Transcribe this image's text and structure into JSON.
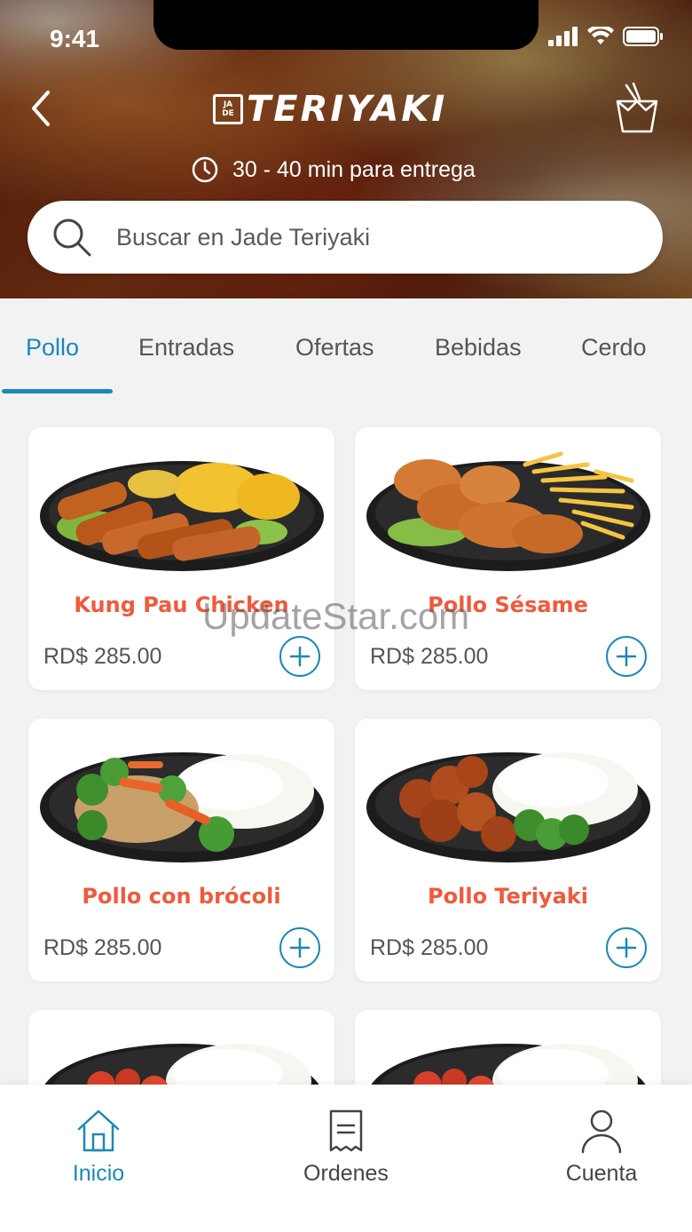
{
  "status_bar": {
    "time": "9:41"
  },
  "header": {
    "logo_mark_top": "JA",
    "logo_mark_bottom": "DE",
    "logo_text": "TERIYAKI",
    "eta": "30 - 40 min para entrega",
    "search_placeholder": "Buscar en Jade Teriyaki"
  },
  "tabs": [
    {
      "label": "Pollo",
      "active": true
    },
    {
      "label": "Entradas",
      "active": false
    },
    {
      "label": "Ofertas",
      "active": false
    },
    {
      "label": "Bebidas",
      "active": false
    },
    {
      "label": "Cerdo",
      "active": false
    }
  ],
  "products": [
    {
      "name": "Kung Pau Chicken",
      "price": "RD$ 285.00"
    },
    {
      "name": "Pollo Sésame",
      "price": "RD$ 285.00"
    },
    {
      "name": "Pollo con brócoli",
      "price": "RD$ 285.00"
    },
    {
      "name": "Pollo Teriyaki",
      "price": "RD$ 285.00"
    }
  ],
  "watermark": "UpdateStar.com",
  "bottom_nav": [
    {
      "label": "Inicio",
      "icon": "home-icon",
      "active": true
    },
    {
      "label": "Ordenes",
      "icon": "receipt-icon",
      "active": false
    },
    {
      "label": "Cuenta",
      "icon": "user-icon",
      "active": false
    }
  ],
  "colors": {
    "accent": "#1b88b8",
    "product_name": "#f05a3c"
  }
}
